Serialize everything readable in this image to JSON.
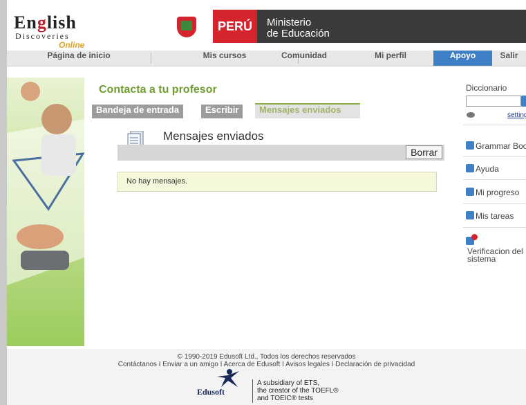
{
  "header": {
    "logo": {
      "line1_a": "En",
      "line1_b": "g",
      "line1_c": "lish",
      "line2": "Discoveries",
      "line3": "Online"
    },
    "peru_label": "PERÚ",
    "ministerio_line1": "Ministerio",
    "ministerio_line2": "de Educación"
  },
  "nav": {
    "items": [
      {
        "label": "Página de inicio"
      },
      {
        "label": "Mis cursos"
      },
      {
        "label": "Comunidad"
      },
      {
        "label": "Mi perfil"
      },
      {
        "label": "Apoyo"
      },
      {
        "label": "Salir"
      }
    ],
    "active_color": "#3f7fc6"
  },
  "main": {
    "title": "Contacta a tu profesor",
    "tabs": [
      {
        "label": "Bandeja de entrada"
      },
      {
        "label": "Escribir"
      },
      {
        "label": "Mensajes enviados"
      }
    ],
    "panel_title": "Mensajes enviados",
    "delete_button": "Borrar",
    "empty_message": "No hay mensajes.",
    "accent_color": "#6f9c2e"
  },
  "sidebar": {
    "dictionary_label": "Diccionario",
    "settings_label": "settings",
    "items": [
      {
        "label": "Grammar Book",
        "icon": "grammar-book-icon"
      },
      {
        "label": "Ayuda",
        "icon": "help-icon"
      },
      {
        "label": "Mi progreso",
        "icon": "progress-icon"
      },
      {
        "label": "Mis tareas",
        "icon": "tasks-icon"
      },
      {
        "label": "Verificacion del sistema",
        "icon": "system-check-icon"
      }
    ]
  },
  "footer": {
    "copyright": "© 1990-2019 Edusoft Ltd., Todos los derechos reservados",
    "links": "Contáctanos I  Enviar a un amigo I  Acerca de Edusoft  I  Avisos legales I  Declaración de privacidad",
    "brand": "Edusoft",
    "subsidiary_1": "A subsidiary of ETS,",
    "subsidiary_2": "the creator of the TOEFL®",
    "subsidiary_3": "and TOEIC® tests"
  }
}
